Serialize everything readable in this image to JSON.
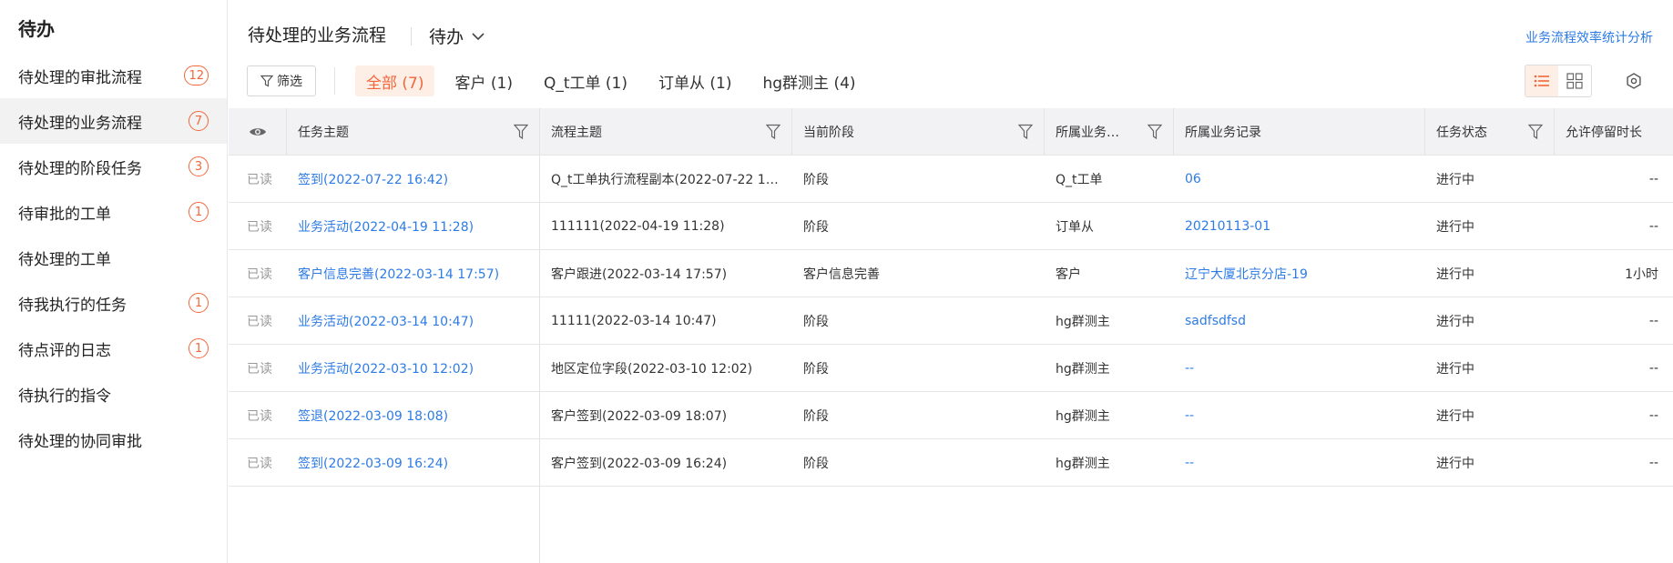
{
  "sidebar": {
    "title": "待办",
    "items": [
      {
        "label": "待处理的审批流程",
        "badge": "12"
      },
      {
        "label": "待处理的业务流程",
        "badge": "7"
      },
      {
        "label": "待处理的阶段任务",
        "badge": "3"
      },
      {
        "label": "待审批的工单",
        "badge": "1"
      },
      {
        "label": "待处理的工单",
        "badge": ""
      },
      {
        "label": "待我执行的任务",
        "badge": "1"
      },
      {
        "label": "待点评的日志",
        "badge": "1"
      },
      {
        "label": "待执行的指令",
        "badge": ""
      },
      {
        "label": "待处理的协同审批",
        "badge": ""
      }
    ]
  },
  "header": {
    "title": "待处理的业务流程",
    "dropdown": "待办",
    "link": "业务流程效率统计分析"
  },
  "toolbar": {
    "filter_label": "筛选",
    "tabs": [
      {
        "label": "全部 (7)"
      },
      {
        "label": "客户 (1)"
      },
      {
        "label": "Q_t工单 (1)"
      },
      {
        "label": "订单从 (1)"
      },
      {
        "label": "hg群测主 (4)"
      }
    ]
  },
  "table": {
    "headers": [
      "任务主题",
      "流程主题",
      "当前阶段",
      "所属业务…",
      "所属业务记录",
      "任务状态",
      "允许停留时长"
    ],
    "rows": [
      {
        "read": "已读",
        "task": "签到(2022-07-22 16:42)",
        "flow": "Q_t工单执行流程副本(2022-07-22 1…",
        "stage": "阶段",
        "biz": "Q_t工单",
        "record": "06",
        "status": "进行中",
        "allow": "--"
      },
      {
        "read": "已读",
        "task": "业务活动(2022-04-19 11:28)",
        "flow": "111111(2022-04-19 11:28)",
        "stage": "阶段",
        "biz": "订单从",
        "record": "20210113-01",
        "status": "进行中",
        "allow": "--"
      },
      {
        "read": "已读",
        "task": "客户信息完善(2022-03-14 17:57)",
        "flow": "客户跟进(2022-03-14 17:57)",
        "stage": "客户信息完善",
        "biz": "客户",
        "record": "辽宁大厦北京分店-19",
        "status": "进行中",
        "allow": "1小时"
      },
      {
        "read": "已读",
        "task": "业务活动(2022-03-14 10:47)",
        "flow": "11111(2022-03-14 10:47)",
        "stage": "阶段",
        "biz": "hg群测主",
        "record": "sadfsdfsd",
        "status": "进行中",
        "allow": "--"
      },
      {
        "read": "已读",
        "task": "业务活动(2022-03-10 12:02)",
        "flow": "地区定位字段(2022-03-10 12:02)",
        "stage": "阶段",
        "biz": "hg群测主",
        "record": "--",
        "status": "进行中",
        "allow": "--"
      },
      {
        "read": "已读",
        "task": "签退(2022-03-09 18:08)",
        "flow": "客户签到(2022-03-09 18:07)",
        "stage": "阶段",
        "biz": "hg群测主",
        "record": "--",
        "status": "进行中",
        "allow": "--"
      },
      {
        "read": "已读",
        "task": "签到(2022-03-09 16:24)",
        "flow": "客户签到(2022-03-09 16:24)",
        "stage": "阶段",
        "biz": "hg群测主",
        "record": "--",
        "status": "进行中",
        "allow": "--"
      }
    ]
  },
  "colors": {
    "accent": "#f2673b",
    "link": "#2d7be5"
  }
}
